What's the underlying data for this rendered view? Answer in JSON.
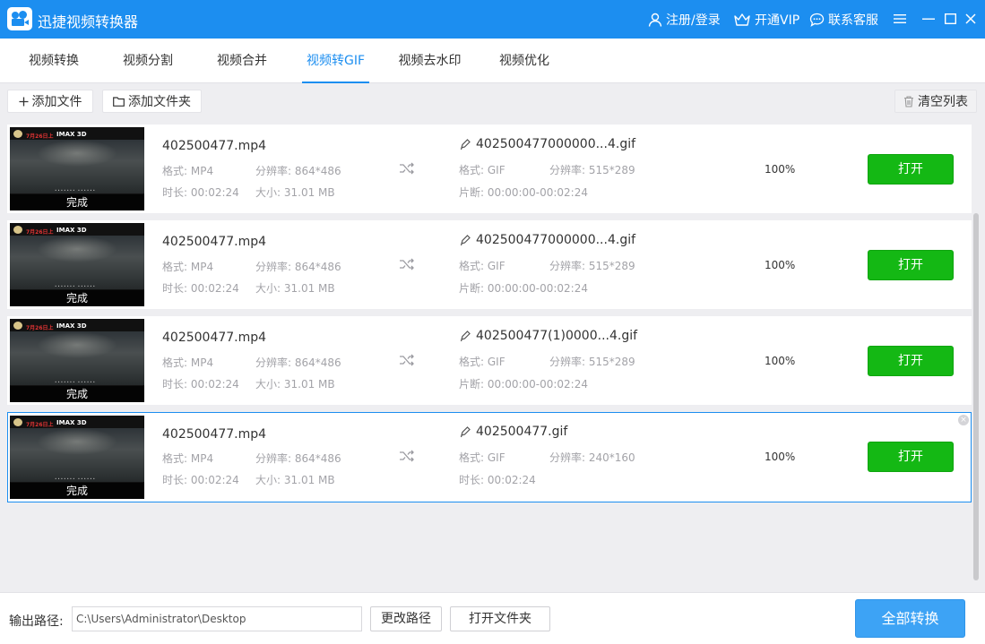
{
  "app": {
    "title": "迅捷视频转换器"
  },
  "titlebar": {
    "login": "注册/登录",
    "vip": "开通VIP",
    "service": "联系客服"
  },
  "tabs": [
    {
      "label": "视频转换"
    },
    {
      "label": "视频分割"
    },
    {
      "label": "视频合并"
    },
    {
      "label": "视频转GIF",
      "active": true
    },
    {
      "label": "视频去水印"
    },
    {
      "label": "视频优化"
    }
  ],
  "toolbar": {
    "add_file": "添加文件",
    "add_folder": "添加文件夹",
    "clear_list": "清空列表"
  },
  "labels": {
    "format": "格式:",
    "resolution": "分辨率:",
    "duration": "时长:",
    "size": "大小:",
    "segment": "片断:",
    "done": "完成",
    "open": "打开"
  },
  "files": [
    {
      "name": "402500477.mp4",
      "format": "MP4",
      "resolution": "864*486",
      "duration": "00:02:24",
      "size": "31.01 MB",
      "out_name": "402500477000000...4.gif",
      "out_format": "GIF",
      "out_resolution": "515*289",
      "out_time_label": "片断:",
      "out_time": "00:00:00-00:02:24",
      "progress": "100%"
    },
    {
      "name": "402500477.mp4",
      "format": "MP4",
      "resolution": "864*486",
      "duration": "00:02:24",
      "size": "31.01 MB",
      "out_name": "402500477000000...4.gif",
      "out_format": "GIF",
      "out_resolution": "515*289",
      "out_time_label": "片断:",
      "out_time": "00:00:00-00:02:24",
      "progress": "100%"
    },
    {
      "name": "402500477.mp4",
      "format": "MP4",
      "resolution": "864*486",
      "duration": "00:02:24",
      "size": "31.01 MB",
      "out_name": "402500477(1)0000...4.gif",
      "out_format": "GIF",
      "out_resolution": "515*289",
      "out_time_label": "片断:",
      "out_time": "00:00:00-00:02:24",
      "progress": "100%"
    },
    {
      "name": "402500477.mp4",
      "format": "MP4",
      "resolution": "864*486",
      "duration": "00:02:24",
      "size": "31.01 MB",
      "out_name": "402500477.gif",
      "out_format": "GIF",
      "out_resolution": "240*160",
      "out_time_label": "时长:",
      "out_time": "00:02:24",
      "progress": "100%"
    }
  ],
  "thumbnail": {
    "imax": "IMAX 3D",
    "red": "7月26日上"
  },
  "footer": {
    "output_label": "输出路径:",
    "output_path": "C:\\Users\\Administrator\\Desktop",
    "change_path": "更改路径",
    "open_folder": "打开文件夹",
    "convert_all": "全部转换"
  },
  "colors": {
    "primary": "#1c8ef0",
    "open_button": "#14b814",
    "convert_button": "#3da3f5"
  }
}
